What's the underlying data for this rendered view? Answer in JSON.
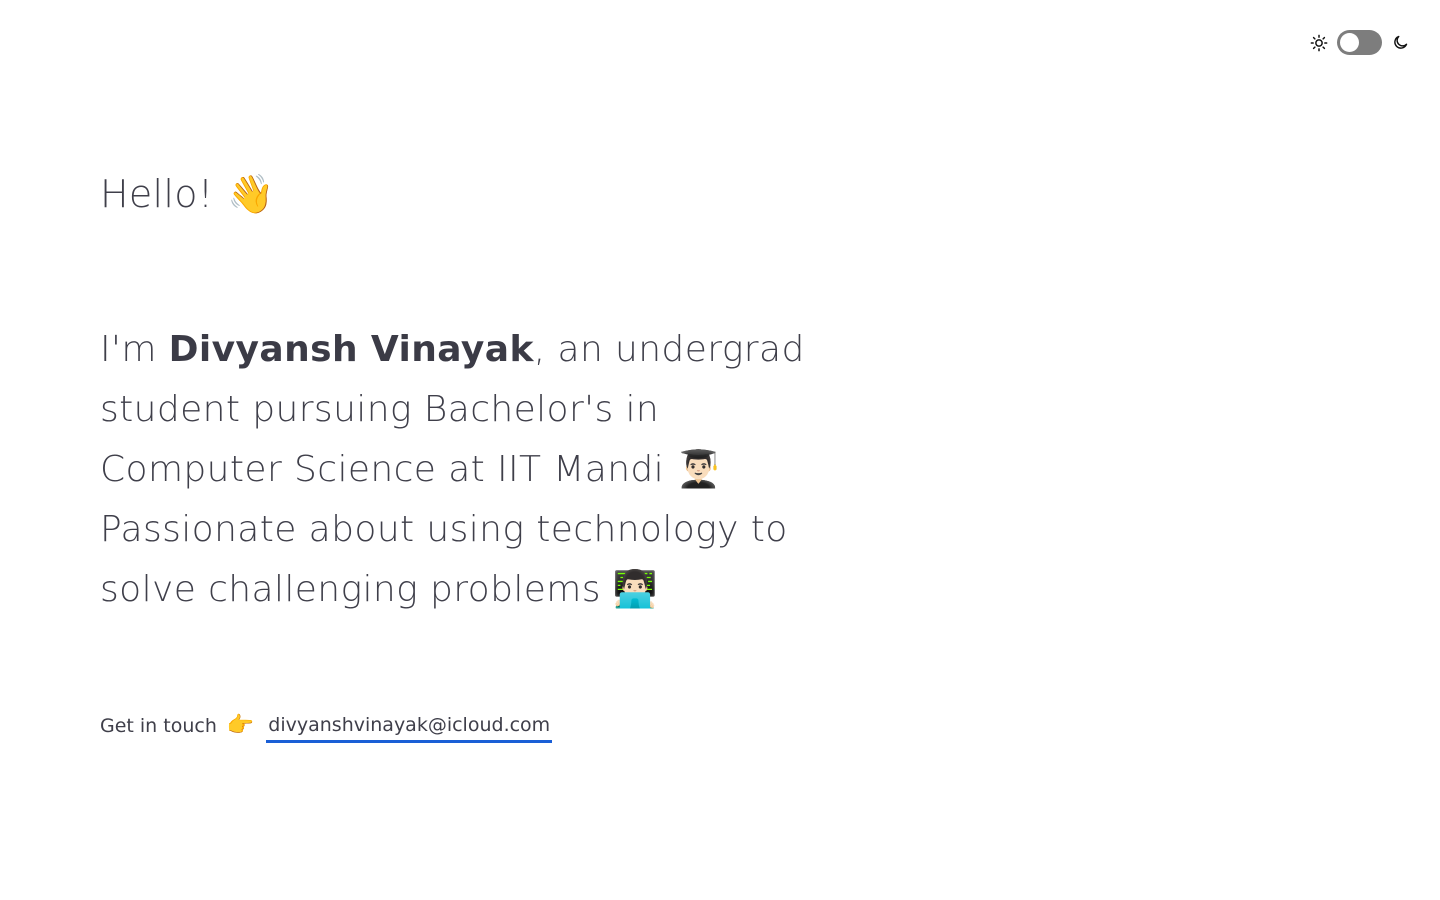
{
  "theme_toggle": {
    "light_icon": "sun-icon",
    "dark_icon": "moon-icon",
    "mode": "light"
  },
  "greeting": {
    "text": "Hello!",
    "emoji": "👋",
    "emoji_icon": "waving-hand-icon"
  },
  "intro": {
    "prefix": "I'm ",
    "name": "Divyansh Vinayak",
    "line1_suffix": ", an undergrad",
    "line2": "student pursuing Bachelor's in",
    "line3": "Computer Science at IIT Mandi",
    "line3_emoji": "👨🏻‍🎓",
    "line3_emoji_icon": "student-icon",
    "line4": "Passionate about using technology to",
    "line5": "solve challenging problems",
    "line5_emoji": "👨🏻‍💻",
    "line5_emoji_icon": "technologist-icon"
  },
  "contact": {
    "label": "Get in touch",
    "emoji": "👉",
    "emoji_icon": "pointing-right-icon",
    "email": "divyanshvinayak@icloud.com",
    "link_color": "#1a5fd6"
  }
}
